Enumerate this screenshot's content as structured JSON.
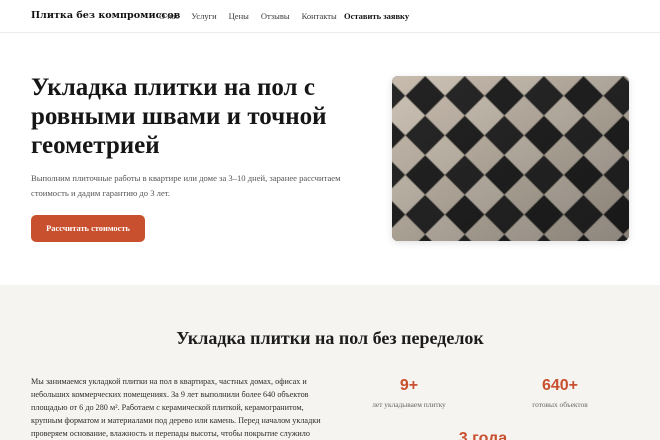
{
  "header": {
    "logo": "Плитка без компромиссов",
    "nav": [
      "О нас",
      "Услуги",
      "Цены",
      "Отзывы",
      "Контакты"
    ],
    "cta": "Оставить заявку"
  },
  "hero": {
    "title": "Укладка плитки на пол с ровными швами и точной геометрией",
    "subtitle": "Выполним плиточные работы в квартире или доме за 3–10 дней, заранее рассчитаем стоимость и дадим гарантию до 3 лет.",
    "button": "Рассчитать стоимость",
    "image_description": "checkerboard-floor-tiles"
  },
  "about": {
    "title": "Укладка плитки на пол без переделок",
    "text": "Мы занимаемся укладкой плитки на пол в квартирах, частных домах, офисах и небольших коммерческих помещениях. За 9 лет выполнили более 640 объектов площадью от 6 до 280 м². Работаем с керамической плиткой, керамогранитом, крупным форматом и материалами под дерево или камень. Перед началом укладки проверяем основание, влажность и перепады высоты, чтобы покрытие служило",
    "stats": [
      {
        "value": "9+",
        "label": "лет укладываем плитку"
      },
      {
        "value": "640+",
        "label": "готовых объектов"
      },
      {
        "value": "3 года",
        "label": ""
      }
    ]
  },
  "colors": {
    "accent": "#c9502f",
    "section_bg": "#f5f4f0"
  }
}
